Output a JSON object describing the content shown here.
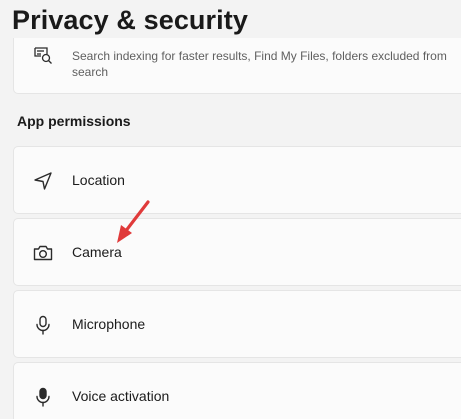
{
  "header": {
    "title": "Privacy & security"
  },
  "search_card": {
    "icon": "search-indexing-icon",
    "description": "Search indexing for faster results, Find My Files, folders excluded from search"
  },
  "app_permissions": {
    "heading": "App permissions",
    "items": [
      {
        "label": "Location",
        "icon": "location-icon"
      },
      {
        "label": "Camera",
        "icon": "camera-icon"
      },
      {
        "label": "Microphone",
        "icon": "microphone-icon"
      },
      {
        "label": "Voice activation",
        "icon": "voice-activation-icon"
      }
    ]
  },
  "annotation": {
    "arrow_color": "#e03a3a",
    "target": "Camera"
  }
}
